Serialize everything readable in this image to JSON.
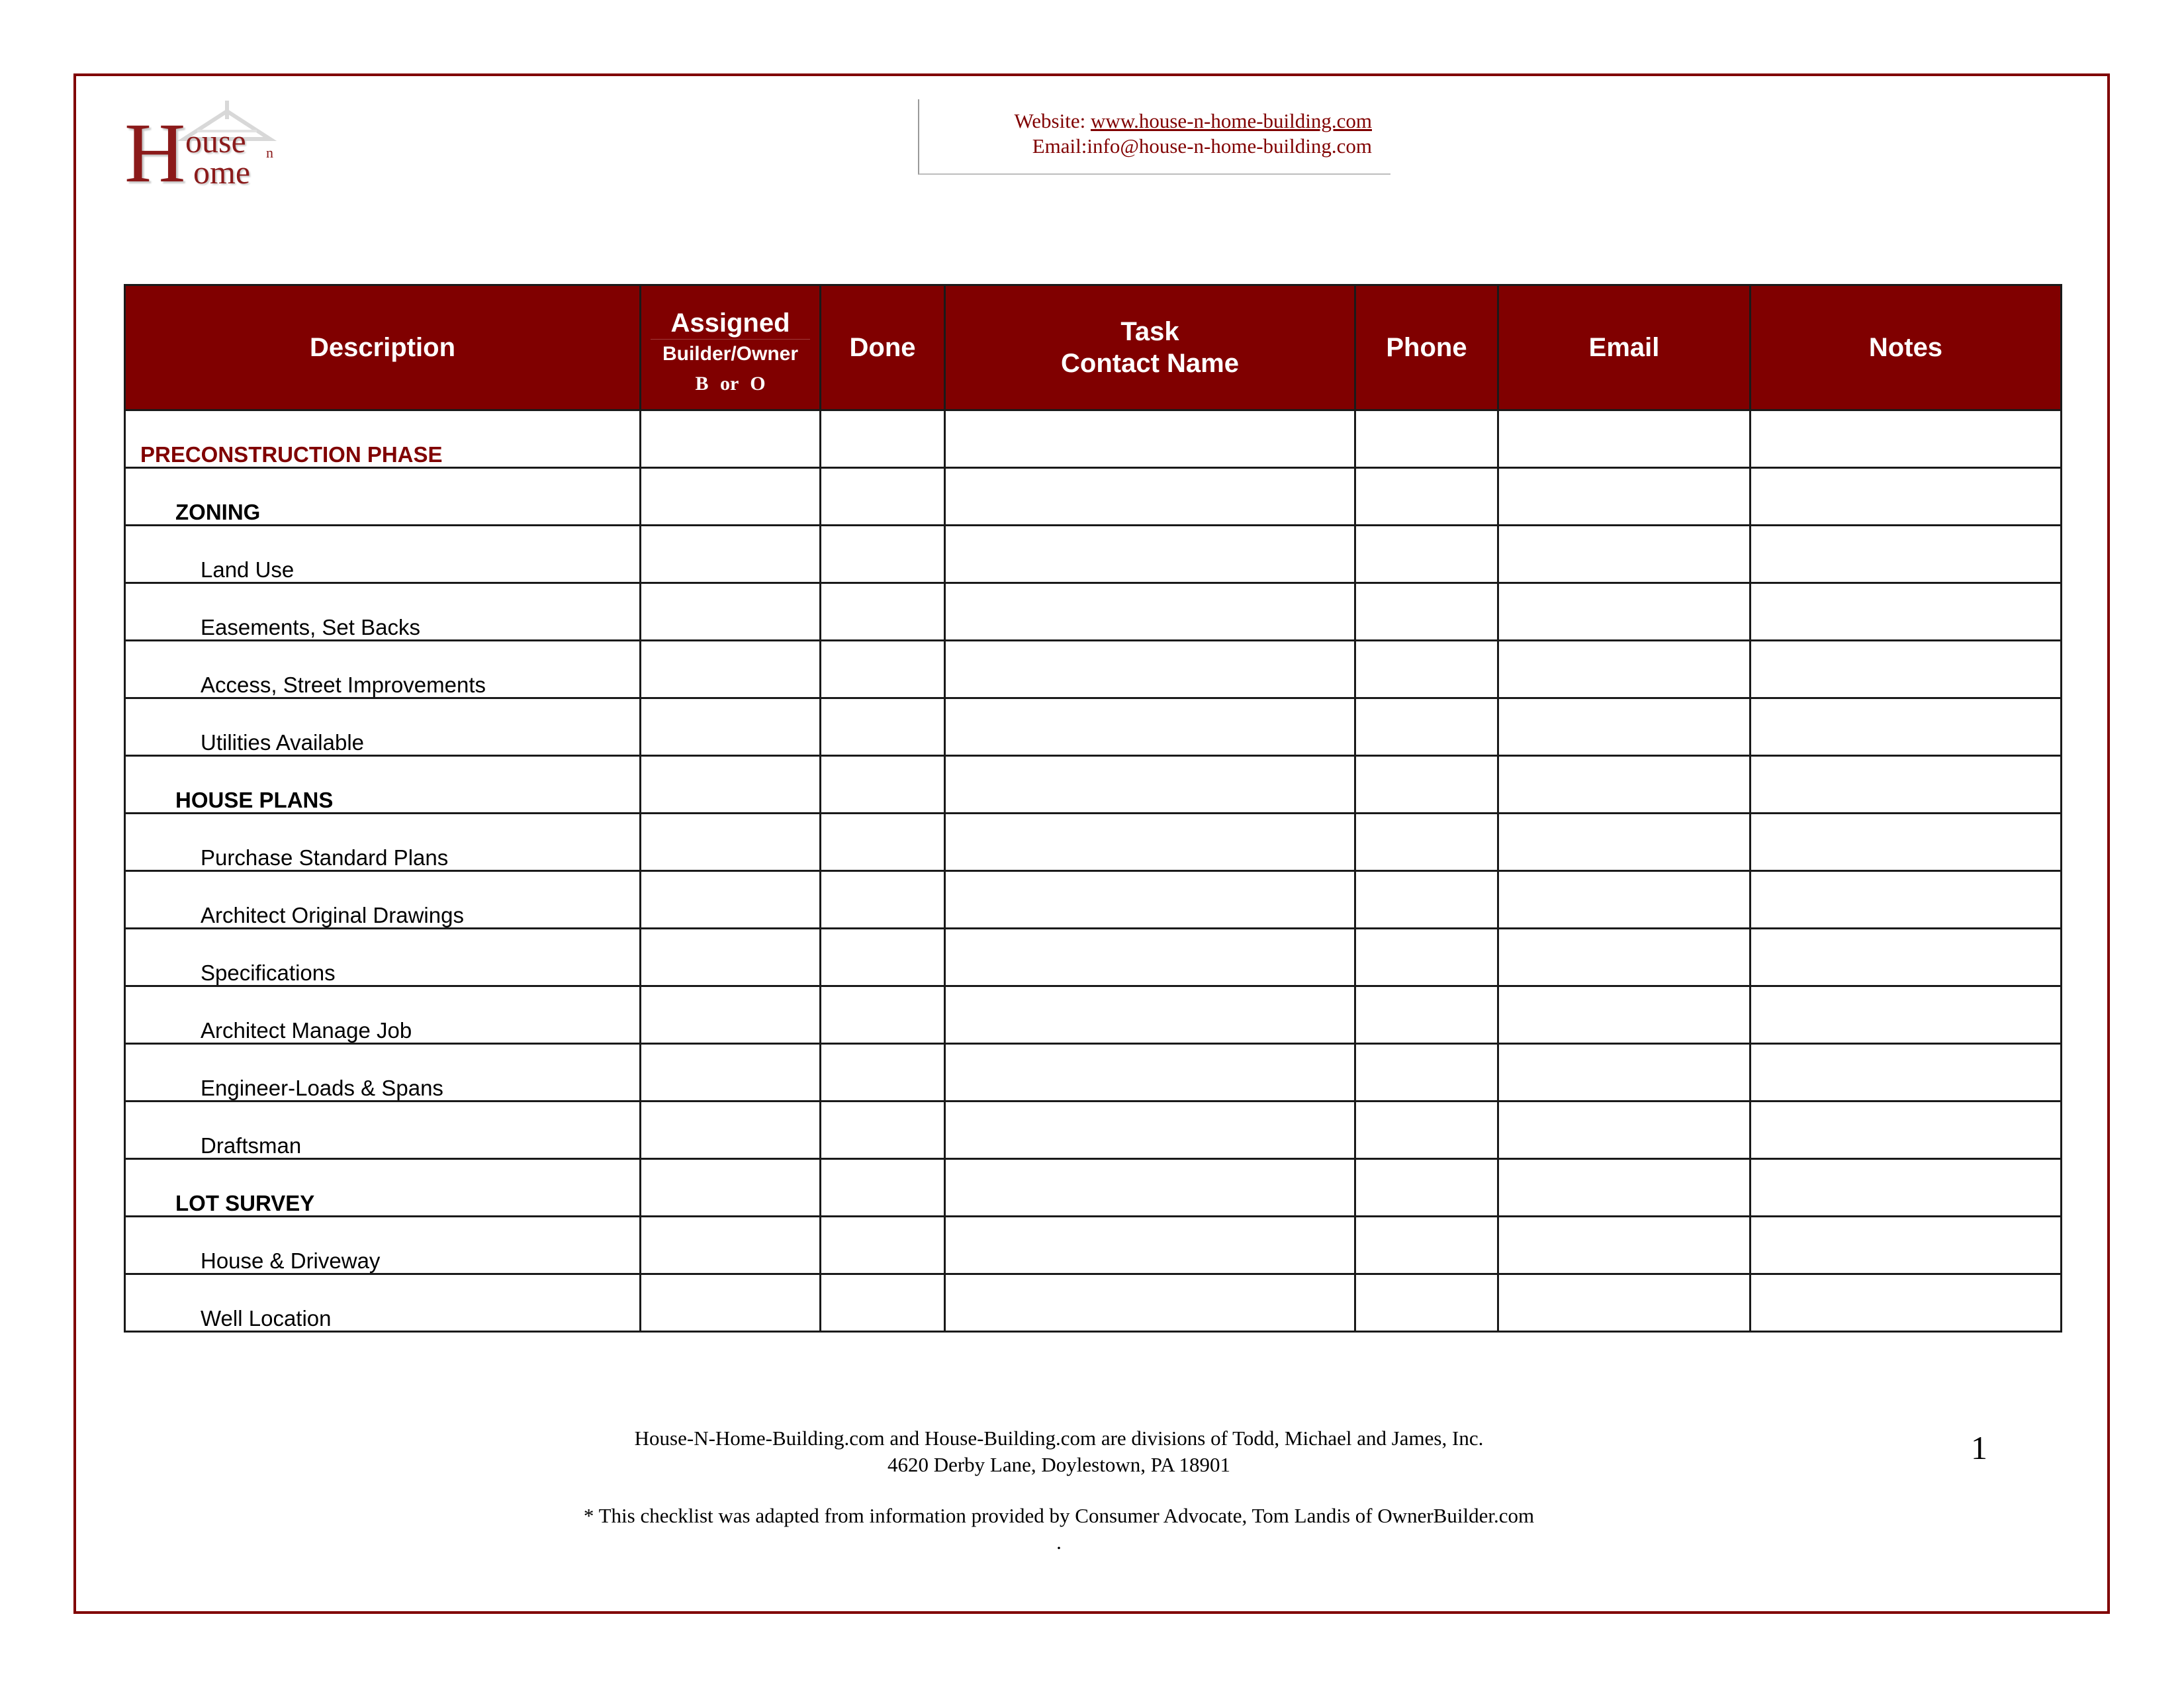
{
  "logo": {
    "initial": "H",
    "word1": "ouse",
    "connector": "n",
    "word2": "ome",
    "icon": "house-roof-icon"
  },
  "contact": {
    "website_label": "Website: ",
    "website_url": "www.house-n-home-building.com",
    "email_line": "Email:info@house-n-home-building.com"
  },
  "table": {
    "columns": {
      "description": "Description",
      "assigned": "Assigned",
      "assigned_sub": "Builder/Owner",
      "assigned_code": "B or O",
      "done": "Done",
      "task_line1": "Task",
      "task_line2": "Contact Name",
      "phone": "Phone",
      "email": "Email",
      "notes": "Notes"
    },
    "rows": [
      {
        "level": "phase",
        "description": "PRECONSTRUCTION PHASE"
      },
      {
        "level": "section",
        "description": "ZONING"
      },
      {
        "level": "item",
        "description": "Land Use"
      },
      {
        "level": "item",
        "description": "Easements, Set Backs"
      },
      {
        "level": "item",
        "description": "Access, Street Improvements"
      },
      {
        "level": "item",
        "description": "Utilities Available"
      },
      {
        "level": "section",
        "description": "HOUSE PLANS"
      },
      {
        "level": "item",
        "description": "Purchase Standard Plans"
      },
      {
        "level": "item",
        "description": "Architect Original Drawings"
      },
      {
        "level": "item",
        "description": "Specifications"
      },
      {
        "level": "item",
        "description": "Architect Manage Job"
      },
      {
        "level": "item",
        "description": "Engineer-Loads & Spans"
      },
      {
        "level": "item",
        "description": "Draftsman"
      },
      {
        "level": "section",
        "description": "LOT SURVEY"
      },
      {
        "level": "item",
        "description": "House & Driveway"
      },
      {
        "level": "item",
        "description": "Well Location"
      }
    ]
  },
  "footer": {
    "line1": "House-N-Home-Building.com and House-Building.com are divisions of Todd, Michael and James, Inc.",
    "line2": "4620 Derby Lane, Doylestown, PA 18901",
    "line3": "* This checklist was adapted from information provided by Consumer Advocate, Tom Landis of OwnerBuilder.com",
    "line4": "."
  },
  "page_number": "1",
  "colors": {
    "brand": "#800000",
    "header_bg": "#800000",
    "header_text": "#ffffff"
  }
}
